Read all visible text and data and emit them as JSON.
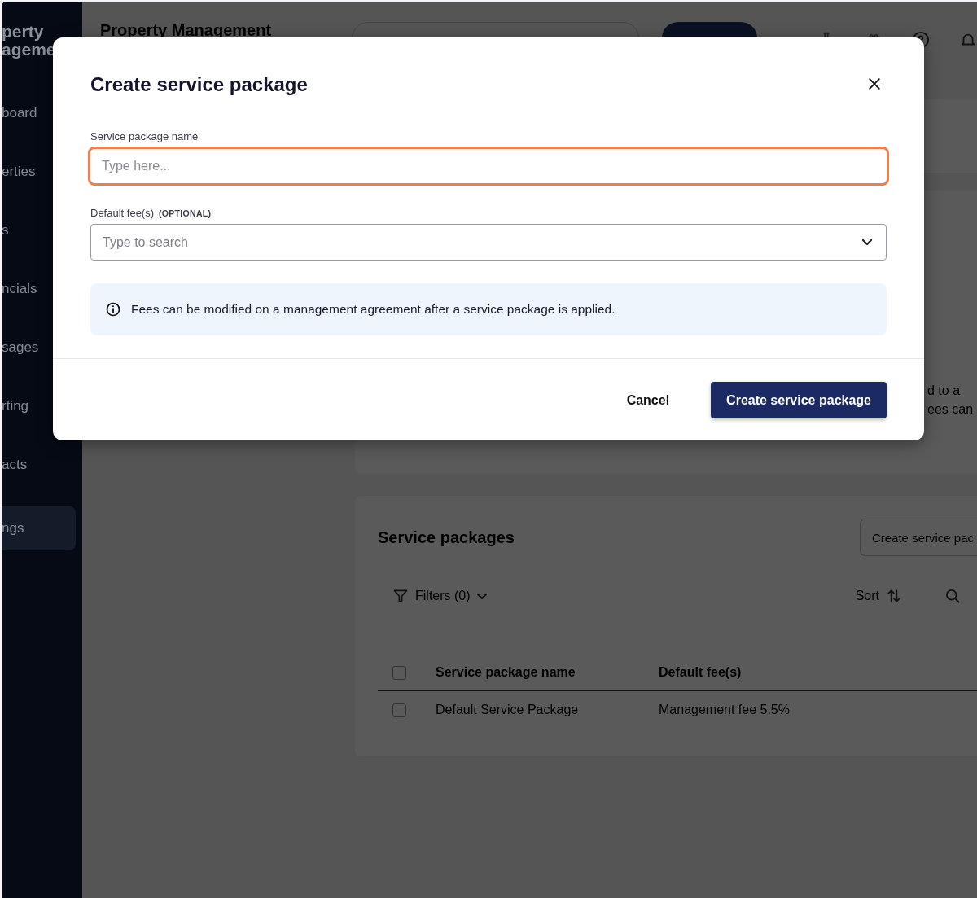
{
  "sidebar": {
    "logo_lines": [
      "perty",
      "ageme"
    ],
    "items": [
      {
        "label": "board",
        "selected": false
      },
      {
        "label": "erties",
        "selected": false
      },
      {
        "label": "s",
        "selected": false
      },
      {
        "label": "ncials",
        "selected": false
      },
      {
        "label": "sages",
        "selected": false
      },
      {
        "label": "rting",
        "selected": false
      },
      {
        "label": "acts",
        "selected": false
      },
      {
        "label": "ngs",
        "selected": true
      }
    ]
  },
  "header": {
    "title": "Property Management"
  },
  "background_card": {
    "lines": [
      "d to a",
      "ees can"
    ]
  },
  "service_packages": {
    "title": "Service packages",
    "create_button": "Create service pac",
    "filters": "Filters (0)",
    "sort": "Sort",
    "table": {
      "header_checked": false,
      "columns": [
        "Service package name",
        "Default fee(s)"
      ],
      "rows": [
        {
          "checked": false,
          "cells": [
            "Default Service Package",
            "Management fee 5.5%"
          ]
        }
      ]
    }
  },
  "dialog": {
    "title": "Create service package",
    "name_field": {
      "label": "Service package name",
      "placeholder": "Type here...",
      "focused": true
    },
    "fees_field": {
      "label": "Default fee(s)",
      "tag": "(OPTIONAL)",
      "placeholder": "Type to search"
    },
    "info": "Fees can be modified on a management agreement after a service package is applied.",
    "buttons": [
      {
        "kind": "secondary",
        "label": "Cancel"
      },
      {
        "kind": "primary",
        "label": "Create service package"
      }
    ]
  }
}
